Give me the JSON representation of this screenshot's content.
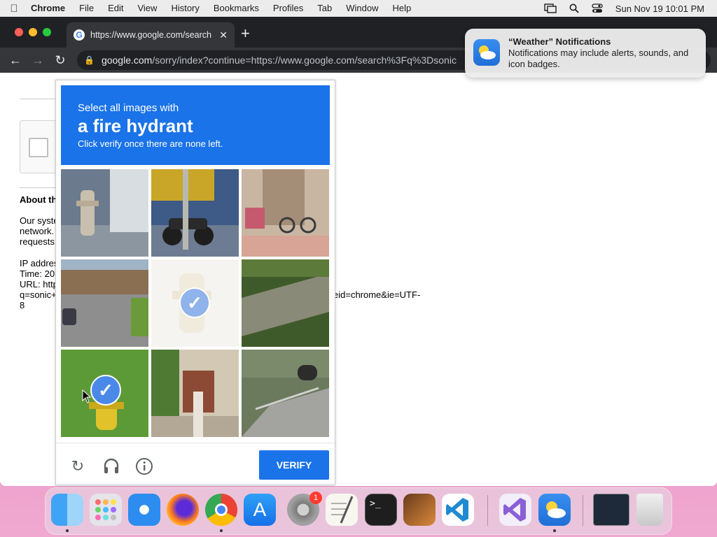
{
  "menubar": {
    "app_name": "Chrome",
    "items": [
      "File",
      "Edit",
      "View",
      "History",
      "Bookmarks",
      "Profiles",
      "Tab",
      "Window",
      "Help"
    ],
    "clock": "Sun Nov 19  10:01 PM"
  },
  "browser": {
    "tab_title": "https://www.google.com/search",
    "url_domain": "google.com",
    "url_path": "/sorry/index?continue=https://www.google.com/search%3Fq%3Dsonic"
  },
  "page": {
    "about_heading": "About th",
    "para_lines": [
      "Our syste",
      "network.",
      "requests"
    ],
    "info_lines": [
      "IP addres",
      "Time: 20",
      "URL: http",
      "q=sonic+",
      "8"
    ],
    "url_tail": "eid=chrome&ie=UTF-"
  },
  "captcha": {
    "instruction_small": "Select all images with",
    "instruction_object": "a fire hydrant",
    "instruction_note": "Click verify once there are none left.",
    "verify_label": "VERIFY",
    "tiles": [
      {
        "name": "hydrant-street",
        "selected": false,
        "faded": false
      },
      {
        "name": "motorcycle-street",
        "selected": false,
        "faded": false
      },
      {
        "name": "bicycles-porch",
        "selected": false,
        "faded": false
      },
      {
        "name": "road-building",
        "selected": false,
        "faded": false
      },
      {
        "name": "hydrant-faded",
        "selected": true,
        "faded": true
      },
      {
        "name": "stone-wall-grass",
        "selected": false,
        "faded": false
      },
      {
        "name": "yellow-hydrant-grass",
        "selected": true,
        "faded": false
      },
      {
        "name": "gate-house",
        "selected": false,
        "faded": false
      },
      {
        "name": "road-tunnel",
        "selected": false,
        "faded": false
      }
    ]
  },
  "notification": {
    "title": "“Weather” Notifications",
    "body": "Notifications may include alerts, sounds, and icon badges."
  },
  "dock": {
    "apps": [
      "finder",
      "launchpad",
      "safari",
      "firefox",
      "chrome",
      "app-store",
      "system-preferences",
      "textedit",
      "terminal",
      "garageband",
      "vscode",
      "visual-studio",
      "weather",
      "screen",
      "trash"
    ],
    "system_preferences_badge": "1"
  }
}
